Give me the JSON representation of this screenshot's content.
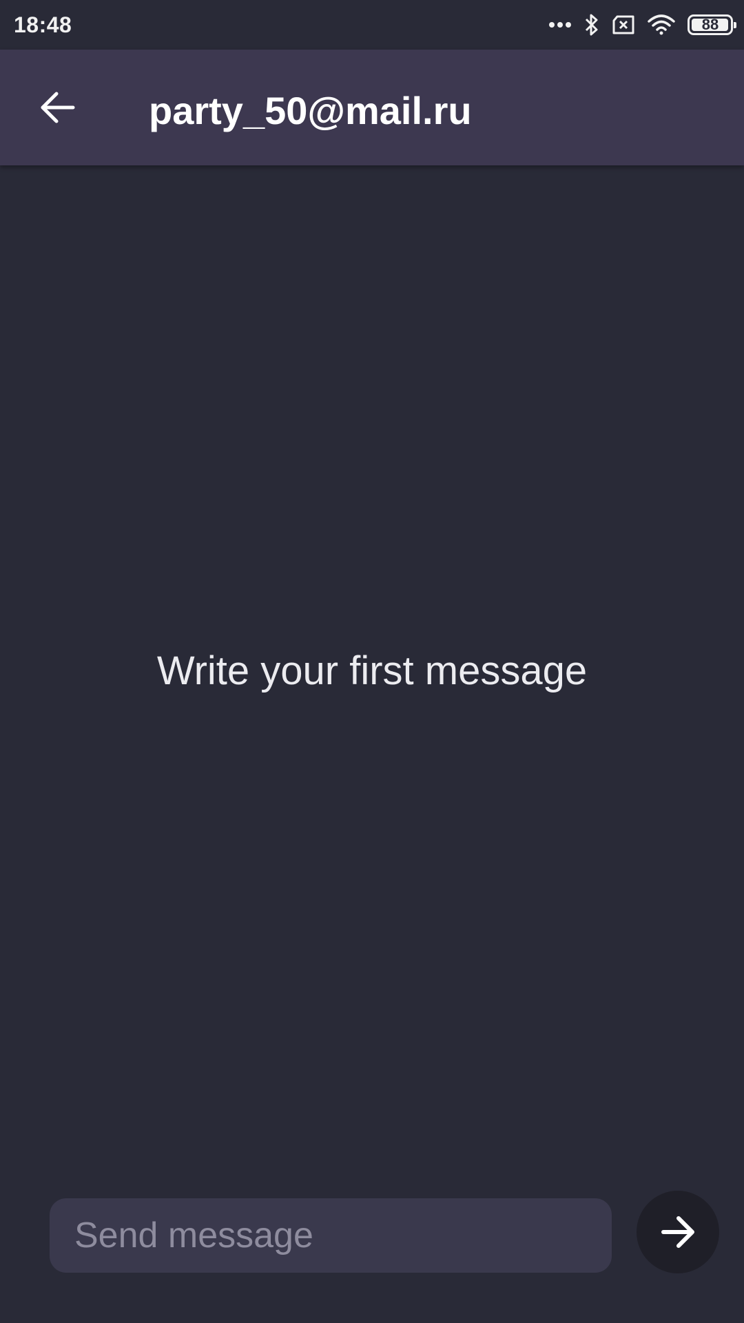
{
  "status_bar": {
    "time": "18:48",
    "battery_level": "88",
    "icons": [
      "more-dots-icon",
      "bluetooth-icon",
      "no-sim-icon",
      "wifi-icon",
      "battery-icon"
    ]
  },
  "app_bar": {
    "title": "party_50@mail.ru",
    "back_icon": "arrow-back-icon"
  },
  "empty_state": {
    "text": "Write your first message"
  },
  "composer": {
    "placeholder": "Send message",
    "value": "",
    "send_icon": "arrow-forward-icon"
  },
  "colors": {
    "background": "#292a37",
    "app_bar": "#3d3850",
    "input_background": "#3a394d",
    "send_button": "#1f1f28",
    "placeholder": "#8e8c9e"
  }
}
